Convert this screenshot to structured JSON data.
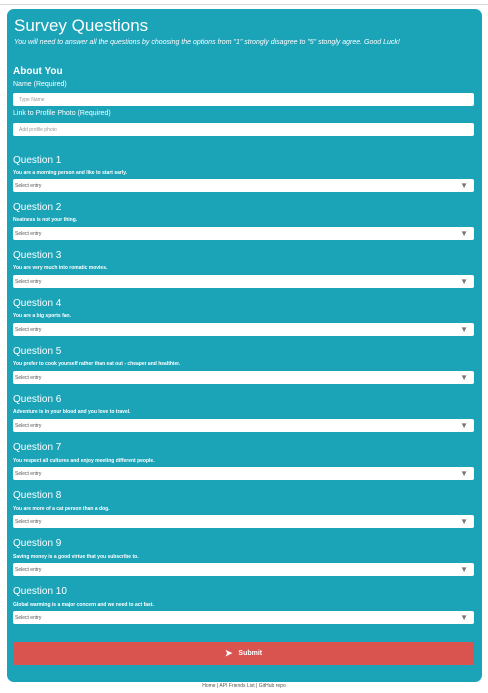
{
  "header": {
    "title": "Survey Questions",
    "subtitle": "You will need to answer all the questions by choosing the options from \"1\" strongly disagree to \"5\" stongly agree. Good Luck!"
  },
  "about": {
    "heading": "About You",
    "name_label": "Name (Required)",
    "name_placeholder": "Type Name",
    "photo_label": "Link to Profile Photo (Required)",
    "photo_placeholder": "Add profile photo"
  },
  "questions": [
    {
      "title": "Question 1",
      "text": "You are a morning person and like to start early.",
      "value": "Select entry"
    },
    {
      "title": "Question 2",
      "text": "Neatness is not your thing.",
      "value": "Select entry"
    },
    {
      "title": "Question 3",
      "text": "You are very much into romatic movies.",
      "value": "Select entry"
    },
    {
      "title": "Question 4",
      "text": "You are a big sports fan.",
      "value": "Select entry"
    },
    {
      "title": "Question 5",
      "text": "You prefer to cook yourself rather than eat out - cheaper and healthier.",
      "value": "Select entry"
    },
    {
      "title": "Question 6",
      "text": "Adventure is in your blood and you love to travel.",
      "value": "Select entry"
    },
    {
      "title": "Question 7",
      "text": "You respect all cultures and enjoy meeting different people.",
      "value": "Select entry"
    },
    {
      "title": "Question 8",
      "text": "You are more of a cat person than a dog.",
      "value": "Select entry"
    },
    {
      "title": "Question 9",
      "text": "Saving money is a good virtue that you subscribe to.",
      "value": "Select entry"
    },
    {
      "title": "Question 10",
      "text": "Global warming is a major concern and we need to act fast.",
      "value": "Select entry"
    }
  ],
  "submit": {
    "label": "Submit",
    "icon": "paper-plane-icon"
  },
  "footer": {
    "home": "Home",
    "sep1": " | ",
    "friends": "API Friends List",
    "sep2": " | ",
    "github": "GitHub repo"
  },
  "colors": {
    "panel": "#1ba3b8",
    "submit": "#d9534f"
  }
}
